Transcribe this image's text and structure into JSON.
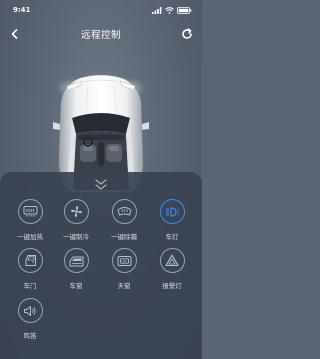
{
  "status_bar": {
    "time": "9:41"
  },
  "nav": {
    "title": "远程控制",
    "back_icon": "chevron-left-icon",
    "refresh_icon": "refresh-icon"
  },
  "controls": [
    {
      "id": "heat",
      "label": "一键加热",
      "icon": "heater-icon",
      "active": false
    },
    {
      "id": "cool",
      "label": "一键制冷",
      "icon": "fan-icon",
      "active": false
    },
    {
      "id": "defrost",
      "label": "一键除霜",
      "icon": "defrost-icon",
      "active": false
    },
    {
      "id": "light",
      "label": "车灯",
      "icon": "headlight-icon",
      "active": true
    },
    {
      "id": "door",
      "label": "车门",
      "icon": "car-door-icon",
      "active": false
    },
    {
      "id": "window",
      "label": "车窗",
      "icon": "car-window-icon",
      "active": false
    },
    {
      "id": "sunroof",
      "label": "天窗",
      "icon": "sunroof-icon",
      "active": false
    },
    {
      "id": "hazard",
      "label": "报警灯",
      "icon": "hazard-light-icon",
      "active": false
    },
    {
      "id": "horn",
      "label": "鸣笛",
      "icon": "speaker-icon",
      "active": false
    }
  ],
  "colors": {
    "accent": "#3a8dff",
    "icon": "#b7bfcb",
    "panel": "#3a4250"
  }
}
